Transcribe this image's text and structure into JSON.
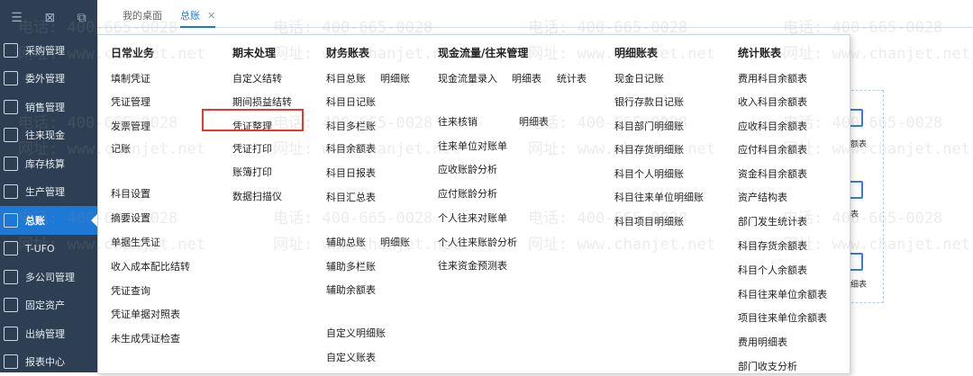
{
  "sidebar": {
    "items": [
      {
        "label": "采购管理",
        "icon": "purchase-icon"
      },
      {
        "label": "委外管理",
        "icon": "outsourcing-icon"
      },
      {
        "label": "销售管理",
        "icon": "sales-icon"
      },
      {
        "label": "往来现金",
        "icon": "cash-icon"
      },
      {
        "label": "库存核算",
        "icon": "inventory-icon"
      },
      {
        "label": "生产管理",
        "icon": "production-icon"
      },
      {
        "label": "总账",
        "icon": "ledger-icon",
        "active": true
      },
      {
        "label": "T-UFO",
        "icon": "ufo-icon"
      },
      {
        "label": "多公司管理",
        "icon": "multi-company-icon"
      },
      {
        "label": "固定资产",
        "icon": "fixed-asset-icon"
      },
      {
        "label": "出纳管理",
        "icon": "cashier-icon"
      },
      {
        "label": "报表中心",
        "icon": "report-center-icon"
      }
    ]
  },
  "tabs": [
    {
      "label": "我的桌面"
    },
    {
      "label": "总账",
      "close": "✕"
    }
  ],
  "menu": {
    "columns": [
      {
        "title": "日常业务",
        "items": [
          "填制凭证",
          "凭证管理",
          "发票管理",
          "记账",
          "科目设置",
          "摘要设置",
          "单据生凭证",
          "收入成本配比结转",
          "凭证查询",
          "凭证单据对照表",
          "未生成凭证检查"
        ]
      },
      {
        "title": "期末处理",
        "items": [
          "自定义结转",
          "期间损益结转",
          "凭证整理",
          "凭证打印",
          "账簿打印",
          "数据扫描仪"
        ]
      },
      {
        "title": "财务账表",
        "items": [
          "科目总账",
          "明细账",
          "科目日记账",
          "科目多栏账",
          "科目余额表",
          "科目日报表",
          "科目汇总表",
          "辅助总账",
          "明细账",
          "辅助多栏账",
          "辅助余额表",
          "自定义明细账",
          "自定义账表"
        ]
      },
      {
        "title": "现金流量/往来管理",
        "items": [
          "现金流量录入",
          "明细表",
          "统计表",
          "往来核销",
          "明细表",
          "往来单位对账单",
          "应收账龄分析",
          "应付账龄分析",
          "个人往来对账单",
          "个人往来账龄分析",
          "往来资金预测表"
        ]
      },
      {
        "title": "明细账表",
        "items": [
          "现金日记账",
          "银行存款日记账",
          "科目部门明细账",
          "科目存货明细账",
          "科目个人明细账",
          "科目往来单位明细账",
          "科目项目明细账"
        ]
      },
      {
        "title": "统计账表",
        "items": [
          "费用科目余额表",
          "收入科目余额表",
          "应收科目余额表",
          "应付科目余额表",
          "资金科目余额表",
          "资产结构表",
          "部门发生统计表",
          "科目存货余额表",
          "科目个人余额表",
          "科目往来单位余额表",
          "项目往来单位余额表",
          "费用明细表",
          "部门收支分析"
        ]
      }
    ]
  },
  "behind": {
    "labels": [
      "额表",
      "表",
      "细表"
    ]
  },
  "watermark": {
    "phone": "电话: 400-665-0028",
    "site": "网址: www.chanjet.net"
  }
}
